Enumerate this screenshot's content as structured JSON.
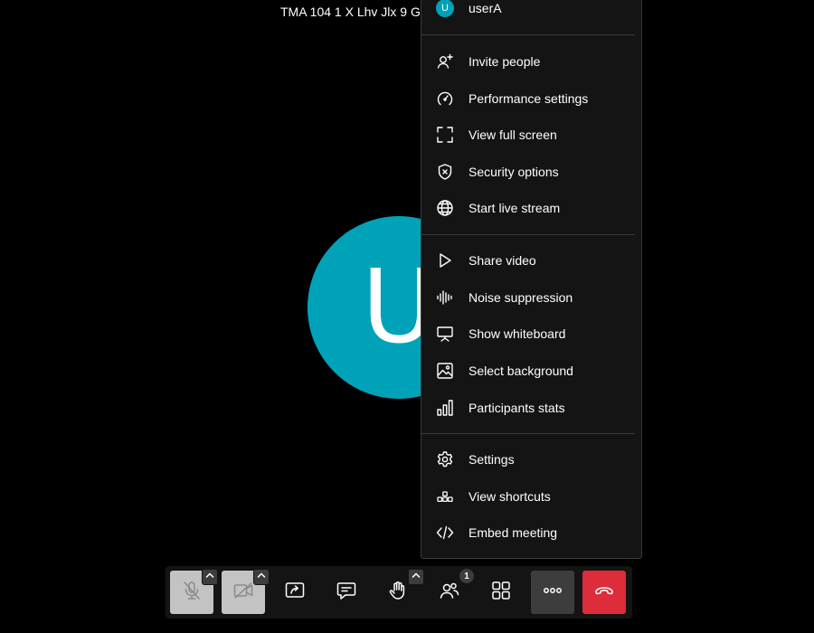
{
  "meeting": {
    "title": "TMA 104 1 X Lhv Jlx 9 G",
    "participant_initial": "U"
  },
  "menu": {
    "user": {
      "initial": "U",
      "name": "userA"
    },
    "groups": [
      [
        {
          "label": "Invite people",
          "icon": "invite-people-icon"
        },
        {
          "label": "Performance settings",
          "icon": "gauge-icon"
        },
        {
          "label": "View full screen",
          "icon": "fullscreen-icon"
        },
        {
          "label": "Security options",
          "icon": "shield-icon"
        },
        {
          "label": "Start live stream",
          "icon": "globe-icon"
        }
      ],
      [
        {
          "label": "Share video",
          "icon": "play-icon"
        },
        {
          "label": "Noise suppression",
          "icon": "audio-wave-icon"
        },
        {
          "label": "Show whiteboard",
          "icon": "whiteboard-icon"
        },
        {
          "label": "Select background",
          "icon": "image-icon"
        },
        {
          "label": "Participants stats",
          "icon": "bar-chart-icon"
        }
      ],
      [
        {
          "label": "Settings",
          "icon": "gear-icon"
        },
        {
          "label": "View shortcuts",
          "icon": "shortcuts-icon"
        },
        {
          "label": "Embed meeting",
          "icon": "code-icon"
        }
      ]
    ]
  },
  "toolbar": {
    "participants_count": "1",
    "buttons": [
      {
        "name": "microphone-button",
        "icon": "mic-off-icon",
        "state": "muted"
      },
      {
        "name": "camera-button",
        "icon": "camera-off-icon",
        "state": "muted"
      },
      {
        "name": "share-screen-button",
        "icon": "share-screen-icon"
      },
      {
        "name": "chat-button",
        "icon": "chat-icon"
      },
      {
        "name": "raise-hand-button",
        "icon": "hand-icon"
      },
      {
        "name": "participants-button",
        "icon": "participants-icon"
      },
      {
        "name": "tile-view-button",
        "icon": "grid-icon"
      },
      {
        "name": "more-actions-button",
        "icon": "more-icon",
        "state": "active"
      },
      {
        "name": "hang-up-button",
        "icon": "phone-hangup-icon"
      }
    ]
  },
  "colors": {
    "accent_avatar": "#00a2b8",
    "hangup": "#dd2c3a",
    "muted_button": "#c3c3c3",
    "menu_bg": "#141414"
  }
}
